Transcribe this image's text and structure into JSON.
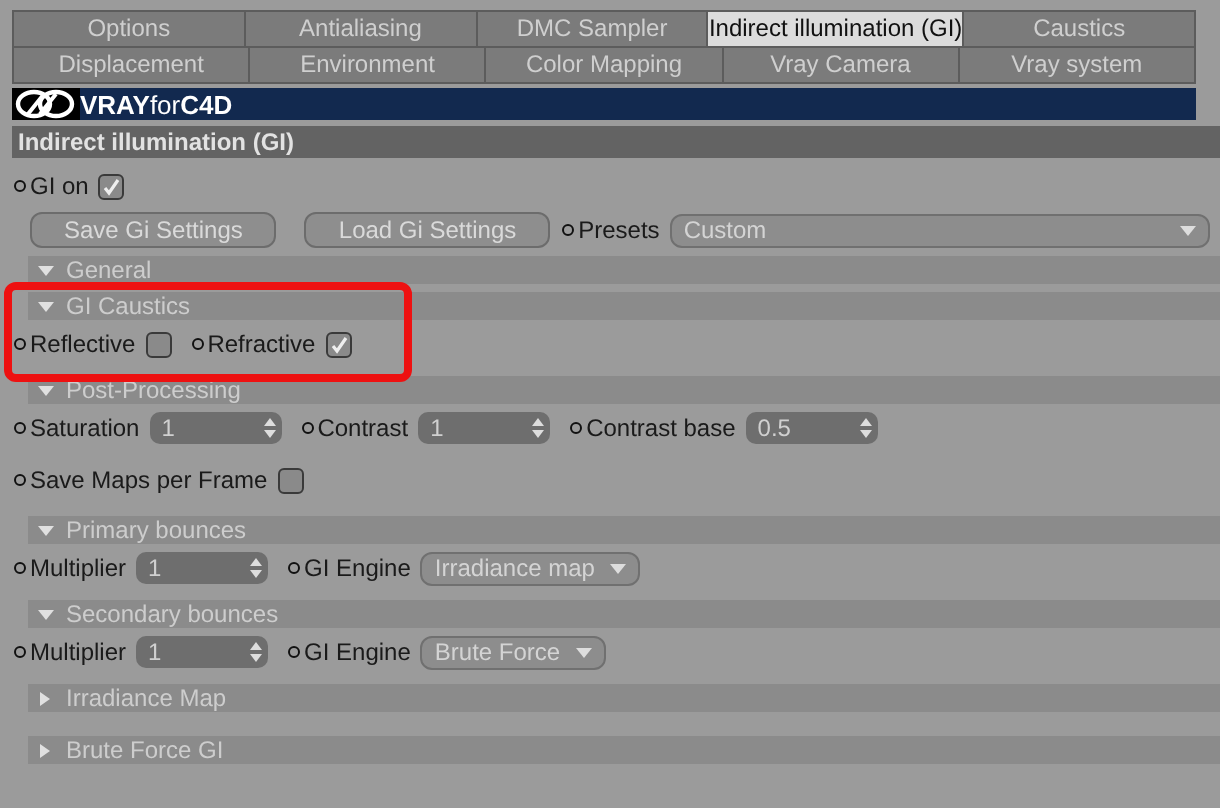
{
  "tab_rows": [
    {
      "tabs": [
        {
          "label": "Options",
          "selected": false
        },
        {
          "label": "Antialiasing",
          "selected": false
        },
        {
          "label": "DMC Sampler",
          "selected": false
        },
        {
          "label": "Indirect illumination (GI)",
          "selected": true
        },
        {
          "label": "Caustics",
          "selected": false
        }
      ]
    },
    {
      "tabs": [
        {
          "label": "Displacement",
          "selected": false
        },
        {
          "label": "Environment",
          "selected": false
        },
        {
          "label": "Color Mapping",
          "selected": false
        },
        {
          "label": "Vray Camera",
          "selected": false
        },
        {
          "label": "Vray system",
          "selected": false
        }
      ]
    }
  ],
  "banner": {
    "brand": "VRAY",
    "brand_small": "for",
    "brand_end": "C4D"
  },
  "panel_title": "Indirect illumination (GI)",
  "gi_on": {
    "label": "GI on",
    "checked": true
  },
  "buttons": [
    "Save Gi Settings",
    "Load Gi Settings"
  ],
  "presets": {
    "label": "Presets",
    "value": "Custom"
  },
  "sections": [
    {
      "title": "General",
      "expanded": true
    },
    {
      "title": "GI Caustics",
      "expanded": true,
      "highlighted": true,
      "rows": [
        [
          {
            "kind": "checkbox",
            "label": "Reflective",
            "checked": false
          },
          {
            "kind": "checkbox",
            "label": "Refractive",
            "checked": true
          }
        ]
      ]
    },
    {
      "title": "Post-Processing",
      "expanded": true,
      "rows": [
        [
          {
            "kind": "spinner",
            "label": "Saturation",
            "value": "1"
          },
          {
            "kind": "spinner",
            "label": "Contrast",
            "value": "1"
          },
          {
            "kind": "spinner",
            "label": "Contrast base",
            "value": "0.5"
          }
        ],
        [
          {
            "kind": "checkbox",
            "label": "Save Maps per Frame",
            "checked": false
          }
        ]
      ]
    },
    {
      "title": "Primary bounces",
      "expanded": true,
      "rows": [
        [
          {
            "kind": "spinner",
            "label": "Multiplier",
            "value": "1"
          },
          {
            "kind": "dropdown",
            "label": "GI Engine",
            "value": "Irradiance map"
          }
        ]
      ]
    },
    {
      "title": "Secondary bounces",
      "expanded": true,
      "rows": [
        [
          {
            "kind": "spinner",
            "label": "Multiplier",
            "value": "1"
          },
          {
            "kind": "dropdown",
            "label": "GI Engine",
            "value": "Brute Force"
          }
        ]
      ]
    },
    {
      "title": "Irradiance Map",
      "expanded": false
    },
    {
      "title": "Brute Force GI",
      "expanded": false
    }
  ]
}
